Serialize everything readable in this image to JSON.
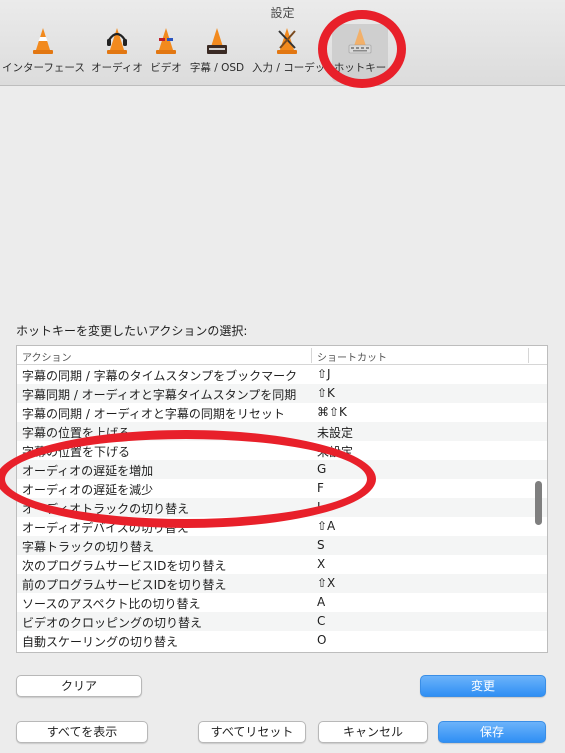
{
  "window": {
    "title": "設定"
  },
  "tabs": [
    {
      "label": "インターフェース",
      "icon": "cone-icon"
    },
    {
      "label": "オーディオ",
      "icon": "cone-headphones-icon"
    },
    {
      "label": "ビデオ",
      "icon": "cone-glasses-icon"
    },
    {
      "label": "字幕 / OSD",
      "icon": "cone-subtitle-icon"
    },
    {
      "label": "入力 / コーデック",
      "icon": "cone-tools-icon"
    },
    {
      "label": "ホットキー",
      "icon": "cone-keyboard-icon",
      "selected": true
    }
  ],
  "hotkeys": {
    "section_label": "ホットキーを変更したいアクションの選択:",
    "columns": {
      "action": "アクション",
      "shortcut": "ショートカット"
    },
    "rows": [
      {
        "action": "字幕の同期 / 字幕のタイムスタンプをブックマーク",
        "shortcut": "⇧J"
      },
      {
        "action": "字幕同期 / オーディオと字幕タイムスタンプを同期",
        "shortcut": "⇧K"
      },
      {
        "action": "字幕の同期 / オーディオと字幕の同期をリセット",
        "shortcut": "⌘⇧K"
      },
      {
        "action": "字幕の位置を上げる",
        "shortcut": "未設定"
      },
      {
        "action": "字幕の位置を下げる",
        "shortcut": "未設定"
      },
      {
        "action": "オーディオの遅延を増加",
        "shortcut": "G"
      },
      {
        "action": "オーディオの遅延を減少",
        "shortcut": "F"
      },
      {
        "action": "オーディオトラックの切り替え",
        "shortcut": "L"
      },
      {
        "action": "オーディオデバイスの切り替え",
        "shortcut": "⇧A"
      },
      {
        "action": "字幕トラックの切り替え",
        "shortcut": "S"
      },
      {
        "action": "次のプログラムサービスIDを切り替え",
        "shortcut": "X"
      },
      {
        "action": "前のプログラムサービスIDを切り替え",
        "shortcut": "⇧X"
      },
      {
        "action": "ソースのアスペクト比の切り替え",
        "shortcut": "A"
      },
      {
        "action": "ビデオのクロッピングの切り替え",
        "shortcut": "C"
      },
      {
        "action": "自動スケーリングの切り替え",
        "shortcut": "O"
      }
    ]
  },
  "buttons": {
    "clear": "クリア",
    "change": "変更",
    "show_all": "すべてを表示",
    "reset_all": "すべてリセット",
    "cancel": "キャンセル",
    "save": "保存"
  },
  "colors": {
    "accent": "#2f8ff4",
    "annotation_ring": "#e8202a",
    "cone_orange": "#f28a1e"
  }
}
